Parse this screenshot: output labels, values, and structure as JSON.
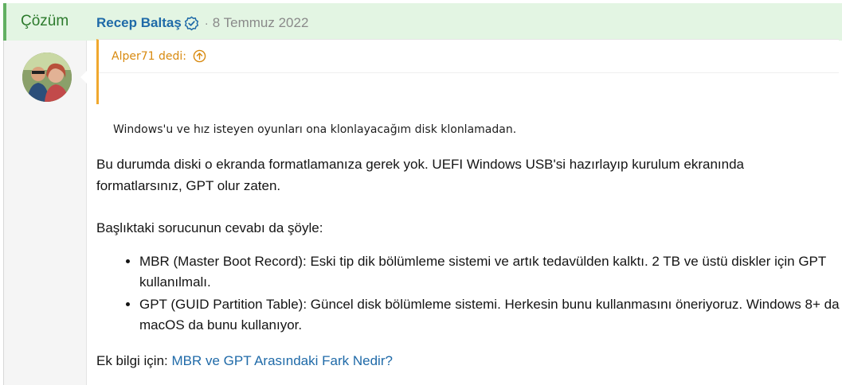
{
  "solution": {
    "label": "Çözüm"
  },
  "post": {
    "author": "Recep Baltaş",
    "separator": "·",
    "date": "8 Temmuz 2022",
    "quote": {
      "author_line": "Alper71 dedi:",
      "text": "Windows'u ve hız isteyen oyunları ona klonlayacağım disk klonlamadan."
    },
    "paragraph1": "Bu durumda diski o ekranda formatlamanıza gerek yok. UEFI Windows USB'si hazırlayıp kurulum ekranında formatlarsınız, GPT olur zaten.",
    "paragraph2": "Başlıktaki sorucunun cevabı da şöyle:",
    "list": [
      "MBR (Master Boot Record): Eski tip dik bölümleme sistemi ve artık tedavülden kalktı. 2 TB ve üstü diskler için GPT kullanılmalı.",
      "GPT (GUID Partition Table): Güncel disk bölümleme sistemi. Herkesin bunu kullanmasını öneriyoruz. Windows 8+ da macOS da bunu kullanıyor."
    ],
    "more_info_prefix": "Ek bilgi için: ",
    "more_info_link": "MBR ve GPT Arasındaki Fark Nedir?"
  },
  "icons": {
    "verified": "verified-badge-icon",
    "quote_jump": "arrow-up-circle-icon"
  },
  "colors": {
    "solution_bg": "#e3f5e3",
    "solution_accent": "#62b062",
    "link": "#1f6aa8",
    "quote_accent": "#f0a82e"
  }
}
